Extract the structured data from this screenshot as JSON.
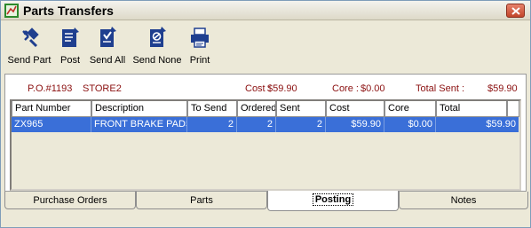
{
  "window": {
    "title": "Parts Transfers"
  },
  "toolbar": {
    "items": [
      {
        "label": "Send Part",
        "icon": "send-part-icon"
      },
      {
        "label": "Post",
        "icon": "post-icon"
      },
      {
        "label": "Send All",
        "icon": "send-all-icon"
      },
      {
        "label": "Send None",
        "icon": "send-none-icon"
      },
      {
        "label": "Print",
        "icon": "printer-icon"
      }
    ]
  },
  "summary": {
    "po": "P.O.#1193",
    "store": "STORE2",
    "cost_label": "Cost :",
    "cost_value": "$59.90",
    "core_label": "Core :",
    "core_value": "$0.00",
    "total_label": "Total Sent :",
    "total_value": "$59.90"
  },
  "grid": {
    "columns": [
      "Part Number",
      "Description",
      "To Send",
      "Ordered",
      "Sent",
      "Cost",
      "Core",
      "Total"
    ],
    "rows": [
      [
        "ZX965",
        "FRONT BRAKE PADS",
        "2",
        "2",
        "2",
        "$59.90",
        "$0.00",
        "$59.90"
      ]
    ]
  },
  "tabs": [
    {
      "label": "Purchase Orders",
      "active": false
    },
    {
      "label": "Parts",
      "active": false
    },
    {
      "label": "Posting",
      "active": true
    },
    {
      "label": "Notes",
      "active": false
    }
  ],
  "colors": {
    "summary_text": "#8b1010",
    "selection": "#3a6fd8",
    "icon_blue": "#1f3f8f"
  }
}
